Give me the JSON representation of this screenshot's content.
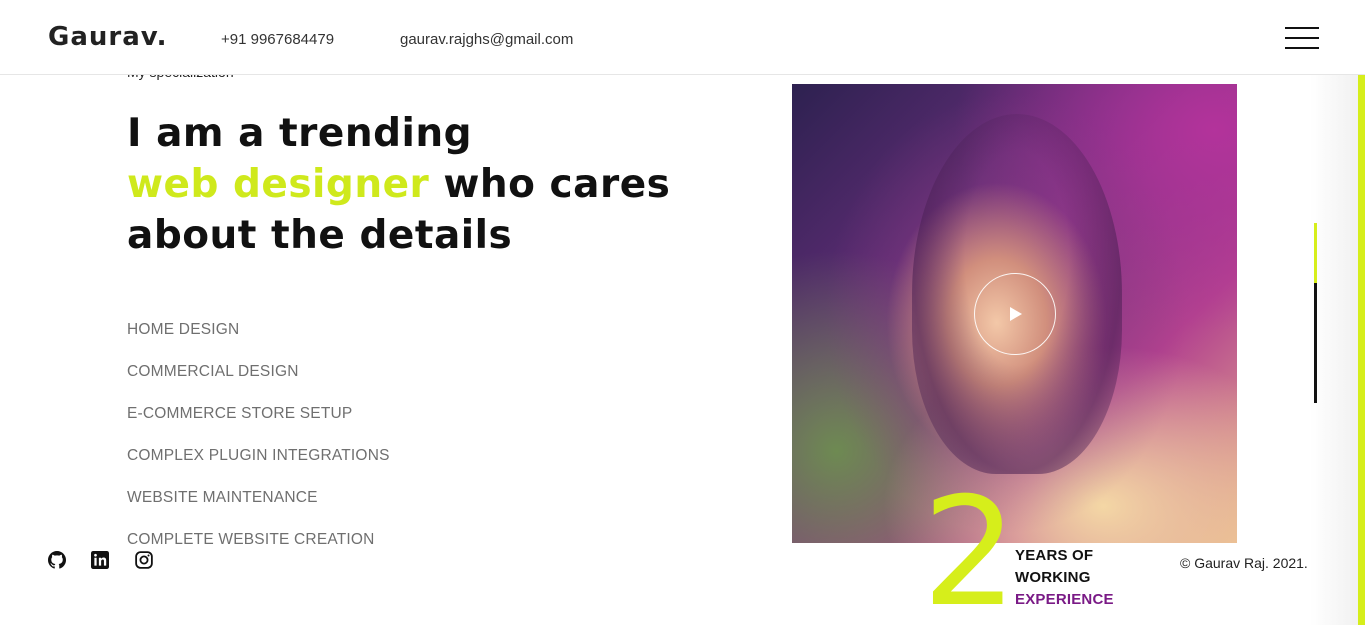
{
  "header": {
    "logo": "Gaurav.",
    "phone": "+91 9967684479",
    "email": "gaurav.rajghs@gmail.com"
  },
  "hero": {
    "eyebrow": "My specialization",
    "headline_line1": "I am a trending",
    "headline_accent": "web designer",
    "headline_line2_rest": " who cares",
    "headline_line3": "about the details"
  },
  "services": [
    "HOME DESIGN",
    "COMMERCIAL DESIGN",
    "E-COMMERCE STORE SETUP",
    "COMPLEX PLUGIN INTEGRATIONS",
    "WEBSITE MAINTENANCE",
    "COMPLETE WEBSITE CREATION"
  ],
  "socials": [
    {
      "icon": "github-icon"
    },
    {
      "icon": "linkedin-icon"
    },
    {
      "icon": "instagram-icon"
    }
  ],
  "experience": {
    "number": "2",
    "line1": "YEARS OF",
    "line2": "WORKING",
    "line3": "EXPERIENCE"
  },
  "footer": {
    "copyright": "© Gaurav Raj. 2021."
  },
  "colors": {
    "accent": "#d6ee1b",
    "purple": "#7a1a86",
    "text": "#111111",
    "muted": "#6f6f6f"
  }
}
